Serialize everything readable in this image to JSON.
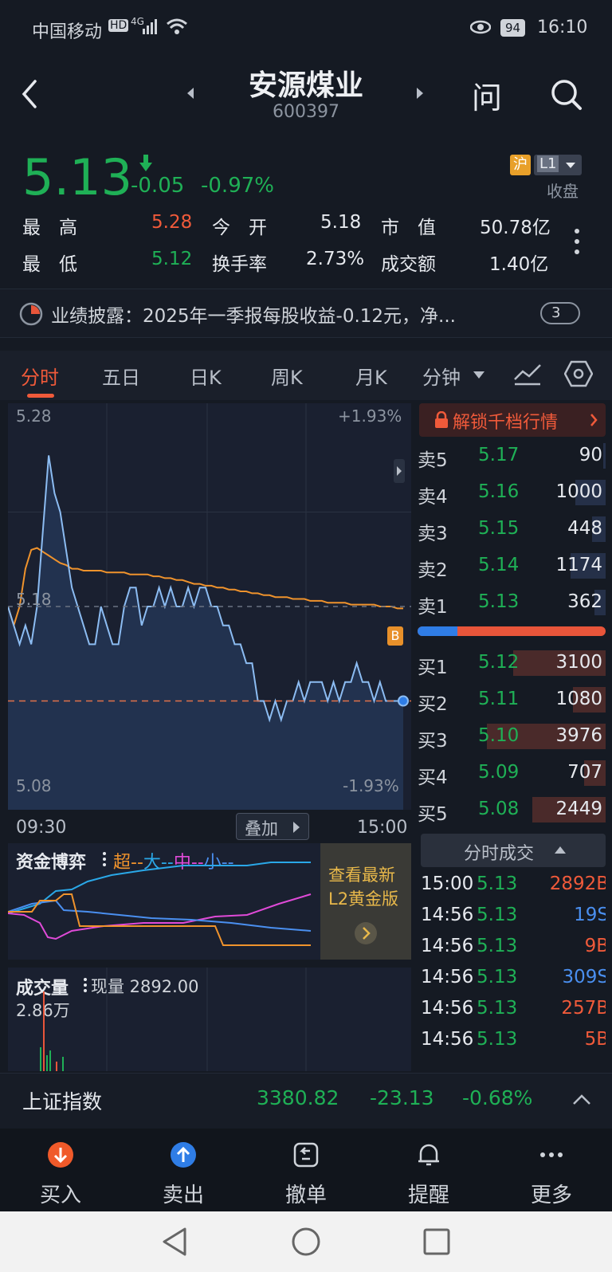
{
  "status": {
    "carrier": "中国移动",
    "hd": "HD",
    "net": "4G",
    "battery": "94",
    "time": "16:10"
  },
  "header": {
    "name": "安源煤业",
    "code": "600397",
    "ask_label": "问"
  },
  "quote": {
    "price": "5.13",
    "change": "-0.05",
    "pct": "-0.97%",
    "market": "沪",
    "level": "L1",
    "state": "收盘",
    "high_label": "最　高",
    "high": "5.28",
    "open_label": "今　开",
    "open": "5.18",
    "mcap_label": "市　值",
    "mcap": "50.78亿",
    "low_label": "最　低",
    "low": "5.12",
    "turnover_label": "换手率",
    "turnover": "2.73%",
    "amount_label": "成交额",
    "amount": "1.40亿"
  },
  "notice": {
    "text": "业绩披露：2025年一季报每股收益-0.12元，净...",
    "count": "3"
  },
  "tabs": [
    "分时",
    "五日",
    "日K",
    "周K",
    "月K",
    "分钟"
  ],
  "chart": {
    "top_price": "5.28",
    "top_pct": "+1.93%",
    "mid_price": "5.18",
    "bot_price": "5.08",
    "bot_pct": "-1.93%",
    "t_start": "09:30",
    "t_end": "15:00",
    "overlay_label": "叠加",
    "b_marker": "B"
  },
  "chart_data": {
    "type": "line",
    "ylim": [
      5.08,
      5.28
    ],
    "series": [
      {
        "values": [
          5.18,
          5.17,
          5.16,
          5.17,
          5.16,
          5.18,
          5.22,
          5.26,
          5.24,
          5.23,
          5.21,
          5.19,
          5.18,
          5.17,
          5.16,
          5.16,
          5.18,
          5.17,
          5.16,
          5.16,
          5.18,
          5.19,
          5.19,
          5.17,
          5.18,
          5.18,
          5.19,
          5.18,
          5.19,
          5.18,
          5.18,
          5.19,
          5.18,
          5.19,
          5.19,
          5.18,
          5.18,
          5.17,
          5.17,
          5.16,
          5.16,
          5.15,
          5.15,
          5.13,
          5.13,
          5.12,
          5.13,
          5.12,
          5.13,
          5.13,
          5.14,
          5.13,
          5.14,
          5.14,
          5.14,
          5.13,
          5.14,
          5.13,
          5.14,
          5.14,
          5.15,
          5.14,
          5.14,
          5.13,
          5.14,
          5.13,
          5.13,
          5.13,
          5.13
        ]
      },
      {
        "values": [
          5.18,
          5.17,
          5.18,
          5.2,
          5.21,
          5.211,
          5.209,
          5.207,
          5.205,
          5.203,
          5.202,
          5.2,
          5.2,
          5.199,
          5.199,
          5.199,
          5.199,
          5.198,
          5.198,
          5.198,
          5.198,
          5.197,
          5.197,
          5.197,
          5.197,
          5.196,
          5.196,
          5.195,
          5.195,
          5.194,
          5.194,
          5.193,
          5.192,
          5.192,
          5.191,
          5.191,
          5.19,
          5.19,
          5.189,
          5.189,
          5.188,
          5.188,
          5.187,
          5.187,
          5.186,
          5.186,
          5.185,
          5.185,
          5.185,
          5.184,
          5.184,
          5.184,
          5.183,
          5.183,
          5.183,
          5.182,
          5.182,
          5.182,
          5.182,
          5.181,
          5.181,
          5.181,
          5.181,
          5.181,
          5.18,
          5.18,
          5.18,
          5.179,
          5.179
        ]
      }
    ]
  },
  "orderbook": {
    "unlock": "解锁千档行情",
    "asks": [
      {
        "l": "卖5",
        "p": "5.17",
        "v": "90"
      },
      {
        "l": "卖4",
        "p": "5.16",
        "v": "1000"
      },
      {
        "l": "卖3",
        "p": "5.15",
        "v": "448"
      },
      {
        "l": "卖2",
        "p": "5.14",
        "v": "1174"
      },
      {
        "l": "卖1",
        "p": "5.13",
        "v": "362"
      }
    ],
    "bids": [
      {
        "l": "买1",
        "p": "5.12",
        "v": "3100"
      },
      {
        "l": "买2",
        "p": "5.11",
        "v": "1080"
      },
      {
        "l": "买3",
        "p": "5.10",
        "v": "3976"
      },
      {
        "l": "买4",
        "p": "5.09",
        "v": "707"
      },
      {
        "l": "买5",
        "p": "5.08",
        "v": "2449"
      }
    ]
  },
  "ticks": {
    "title": "分时成交",
    "rows": [
      {
        "t": "15:00",
        "p": "5.13",
        "v": "2892B"
      },
      {
        "t": "14:56",
        "p": "5.13",
        "v": "19S"
      },
      {
        "t": "14:56",
        "p": "5.13",
        "v": "9B"
      },
      {
        "t": "14:56",
        "p": "5.13",
        "v": "309S"
      },
      {
        "t": "14:56",
        "p": "5.13",
        "v": "257B"
      },
      {
        "t": "14:56",
        "p": "5.13",
        "v": "5B"
      }
    ]
  },
  "capital": {
    "title": "资金博弈",
    "legend_super": "超",
    "legend_big": "大",
    "legend_mid": "中",
    "legend_small": "小",
    "promo_line1": "查看最新",
    "promo_line2": "L2黄金版"
  },
  "volume": {
    "title": "成交量",
    "current": "现量 2892.00",
    "max": "2.86万"
  },
  "index": {
    "name": "上证指数",
    "value": "3380.82",
    "change": "-23.13",
    "pct": "-0.68%"
  },
  "nav": {
    "buy": "买入",
    "sell": "卖出",
    "cancel": "撤单",
    "alert": "提醒",
    "more": "更多"
  }
}
